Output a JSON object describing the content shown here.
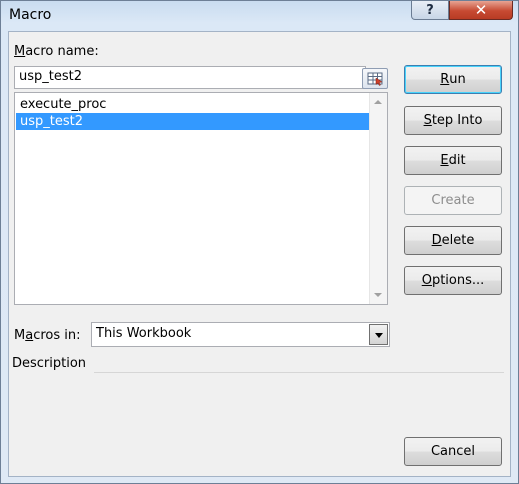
{
  "window": {
    "title": "Macro",
    "help_glyph": "?",
    "close_glyph": "✕"
  },
  "macro_name": {
    "label_pre": "",
    "label_underline": "M",
    "label_post": "acro name:",
    "value": "usp_test2"
  },
  "macro_list": {
    "items": [
      "execute_proc",
      "usp_test2"
    ],
    "selected": "usp_test2"
  },
  "buttons": {
    "run": {
      "pre": "",
      "u": "R",
      "post": "un"
    },
    "step_into": {
      "pre": "",
      "u": "S",
      "post": "tep Into"
    },
    "edit": {
      "pre": "",
      "u": "E",
      "post": "dit"
    },
    "create": {
      "label": "Create"
    },
    "delete": {
      "pre": "",
      "u": "D",
      "post": "elete"
    },
    "options": {
      "pre": "",
      "u": "O",
      "post": "ptions..."
    },
    "cancel": {
      "label": "Cancel"
    }
  },
  "macros_in": {
    "label_pre": "M",
    "label_underline": "a",
    "label_post": "cros in:",
    "value": "This Workbook"
  },
  "description": {
    "label": "Description"
  },
  "icons": {
    "pick": "refedit-icon",
    "dropdown": "chevron-down-icon"
  }
}
